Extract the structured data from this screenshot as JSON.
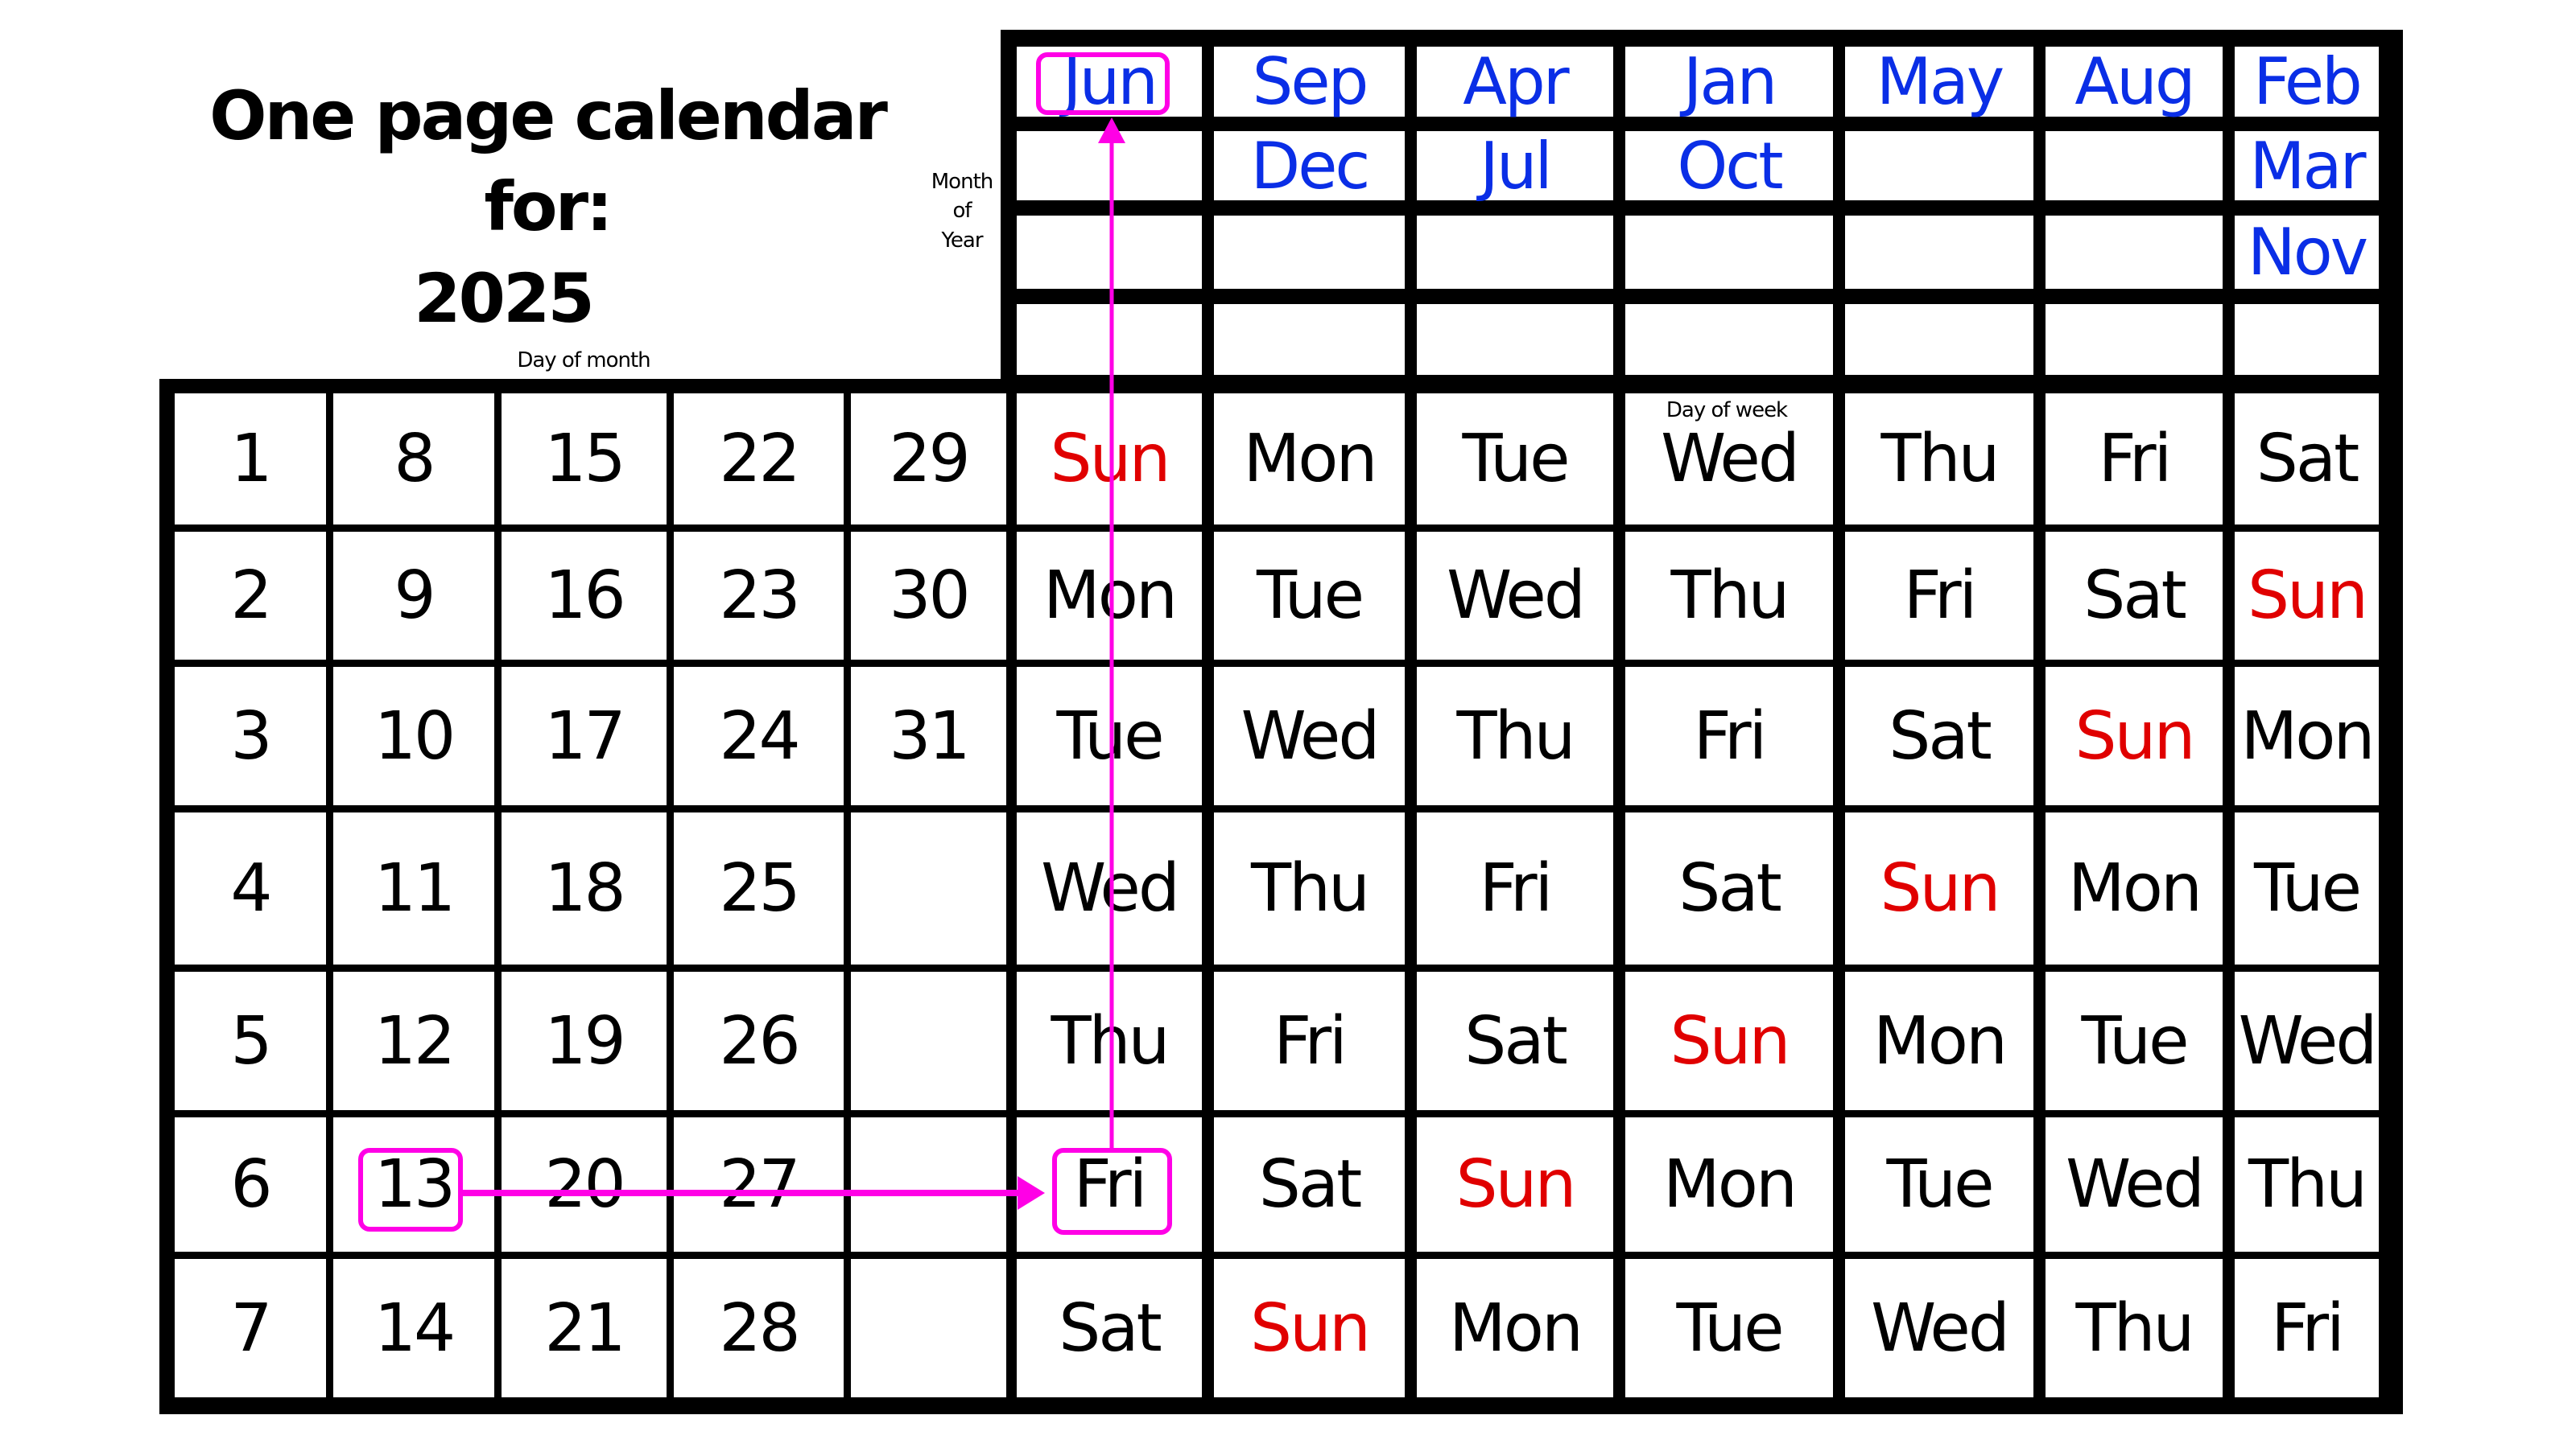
{
  "title": {
    "line1": "One page calendar for:",
    "year": "2025"
  },
  "labels": {
    "month_of_year": [
      "Month",
      "of",
      "Year"
    ],
    "day_of_month": "Day of month",
    "day_of_week": "Day of week"
  },
  "colors": {
    "month_text": "#0a2ee6",
    "sunday_text": "#e00000",
    "highlight": "#ff00e6",
    "grid": "#000000"
  },
  "month_grid": [
    [
      "Jun",
      "Sep",
      "Apr",
      "Jan",
      "May",
      "Aug",
      "Feb"
    ],
    [
      "",
      "Dec",
      "Jul",
      "Oct",
      "",
      "",
      "Mar"
    ],
    [
      "",
      "",
      "",
      "",
      "",
      "",
      "Nov"
    ],
    [
      "",
      "",
      "",
      "",
      "",
      "",
      ""
    ]
  ],
  "day_of_month_grid": [
    [
      "1",
      "8",
      "15",
      "22",
      "29"
    ],
    [
      "2",
      "9",
      "16",
      "23",
      "30"
    ],
    [
      "3",
      "10",
      "17",
      "24",
      "31"
    ],
    [
      "4",
      "11",
      "18",
      "25",
      ""
    ],
    [
      "5",
      "12",
      "19",
      "26",
      ""
    ],
    [
      "6",
      "13",
      "20",
      "27",
      ""
    ],
    [
      "7",
      "14",
      "21",
      "28",
      ""
    ]
  ],
  "weekday_grid": [
    [
      "Sun",
      "Mon",
      "Tue",
      "Wed",
      "Thu",
      "Fri",
      "Sat"
    ],
    [
      "Mon",
      "Tue",
      "Wed",
      "Thu",
      "Fri",
      "Sat",
      "Sun"
    ],
    [
      "Tue",
      "Wed",
      "Thu",
      "Fri",
      "Sat",
      "Sun",
      "Mon"
    ],
    [
      "Wed",
      "Thu",
      "Fri",
      "Sat",
      "Sun",
      "Mon",
      "Tue"
    ],
    [
      "Thu",
      "Fri",
      "Sat",
      "Sun",
      "Mon",
      "Tue",
      "Wed"
    ],
    [
      "Fri",
      "Sat",
      "Sun",
      "Mon",
      "Tue",
      "Wed",
      "Thu"
    ],
    [
      "Sat",
      "Sun",
      "Mon",
      "Tue",
      "Wed",
      "Thu",
      "Fri"
    ]
  ],
  "highlight_example": {
    "month": "Jun",
    "day": "13",
    "weekday": "Fri"
  }
}
